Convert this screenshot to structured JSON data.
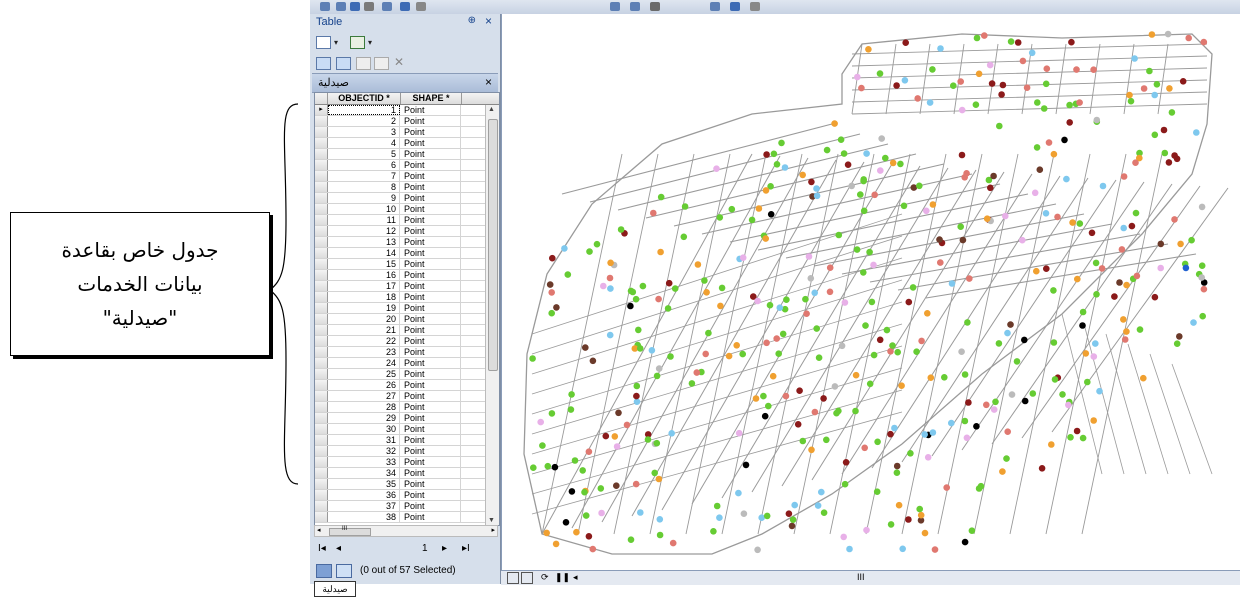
{
  "callout": {
    "line1": "جدول خاص بقاعدة",
    "line2": "بيانات  الخدمات",
    "line3": "\"صيدلية\""
  },
  "panel": {
    "title": "Table",
    "pin_glyph": "⊕",
    "close_glyph": "×"
  },
  "table_tab": {
    "name": "صيدلية",
    "close_glyph": "×"
  },
  "columns": {
    "objectid": "OBJECTID *",
    "shape": "SHAPE *"
  },
  "rows": [
    {
      "id": "1",
      "shape": "Point"
    },
    {
      "id": "2",
      "shape": "Point"
    },
    {
      "id": "3",
      "shape": "Point"
    },
    {
      "id": "4",
      "shape": "Point"
    },
    {
      "id": "5",
      "shape": "Point"
    },
    {
      "id": "6",
      "shape": "Point"
    },
    {
      "id": "7",
      "shape": "Point"
    },
    {
      "id": "8",
      "shape": "Point"
    },
    {
      "id": "9",
      "shape": "Point"
    },
    {
      "id": "10",
      "shape": "Point"
    },
    {
      "id": "11",
      "shape": "Point"
    },
    {
      "id": "12",
      "shape": "Point"
    },
    {
      "id": "13",
      "shape": "Point"
    },
    {
      "id": "14",
      "shape": "Point"
    },
    {
      "id": "15",
      "shape": "Point"
    },
    {
      "id": "16",
      "shape": "Point"
    },
    {
      "id": "17",
      "shape": "Point"
    },
    {
      "id": "18",
      "shape": "Point"
    },
    {
      "id": "19",
      "shape": "Point"
    },
    {
      "id": "20",
      "shape": "Point"
    },
    {
      "id": "21",
      "shape": "Point"
    },
    {
      "id": "22",
      "shape": "Point"
    },
    {
      "id": "23",
      "shape": "Point"
    },
    {
      "id": "24",
      "shape": "Point"
    },
    {
      "id": "25",
      "shape": "Point"
    },
    {
      "id": "26",
      "shape": "Point"
    },
    {
      "id": "27",
      "shape": "Point"
    },
    {
      "id": "28",
      "shape": "Point"
    },
    {
      "id": "29",
      "shape": "Point"
    },
    {
      "id": "30",
      "shape": "Point"
    },
    {
      "id": "31",
      "shape": "Point"
    },
    {
      "id": "32",
      "shape": "Point"
    },
    {
      "id": "33",
      "shape": "Point"
    },
    {
      "id": "34",
      "shape": "Point"
    },
    {
      "id": "35",
      "shape": "Point"
    },
    {
      "id": "36",
      "shape": "Point"
    },
    {
      "id": "37",
      "shape": "Point"
    },
    {
      "id": "38",
      "shape": "Point"
    }
  ],
  "navigation": {
    "first": "I◂",
    "prev": "◂",
    "record": "1",
    "next": "▸",
    "last": "▸I"
  },
  "status": {
    "selection_text": "(0 out of 57 Selected)"
  },
  "bottom_tab": {
    "name": "صيدلية"
  },
  "hscroll": {
    "grip": "III"
  },
  "map_statusbar": {
    "grip": "III"
  },
  "colors": {
    "point_palette": [
      "#66cc33",
      "#e07870",
      "#f0a030",
      "#7ec8ee",
      "#8b1a1a",
      "#6b3a2a",
      "#e8b0e8",
      "#bbbbbb",
      "#000000",
      "#2060d0",
      "#ff3030"
    ],
    "street_stroke": "#9a9a9a",
    "panel_bg": "#d6dfeb"
  }
}
